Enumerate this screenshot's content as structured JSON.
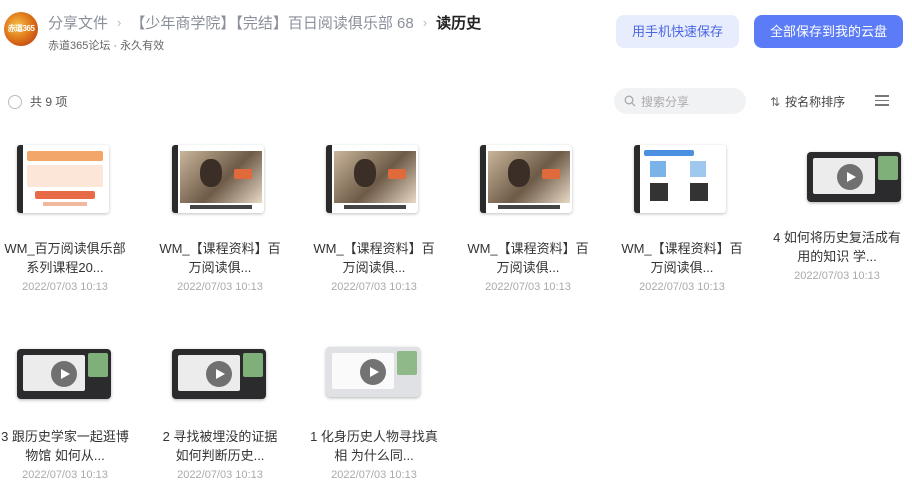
{
  "header": {
    "avatar_text": "赤道365",
    "breadcrumb": [
      "分享文件",
      "【少年商学院】【完结】百日阅读俱乐部 68"
    ],
    "current": "读历史",
    "subline": "赤道365论坛 · 永久有效",
    "btn_mobile": "用手机快速保存",
    "btn_saveall": "全部保存到我的云盘"
  },
  "toolbar": {
    "count": "共 9 项",
    "search_placeholder": "搜索分享",
    "sort": "按名称排序"
  },
  "files": [
    {
      "name": "WM_百万阅读俱乐部系列课程20...",
      "date": "2022/07/03 10:13",
      "kind": "doc-poster"
    },
    {
      "name": "WM_【课程资料】百万阅读俱...",
      "date": "2022/07/03 10:13",
      "kind": "doc-portrait"
    },
    {
      "name": "WM_【课程资料】百万阅读俱...",
      "date": "2022/07/03 10:13",
      "kind": "doc-portrait"
    },
    {
      "name": "WM_【课程资料】百万阅读俱...",
      "date": "2022/07/03 10:13",
      "kind": "doc-portrait"
    },
    {
      "name": "WM_【课程资料】百万阅读俱...",
      "date": "2022/07/03 10:13",
      "kind": "doc-qr"
    },
    {
      "name": "4 如何将历史复活成有用的知识 学...",
      "date": "2022/07/03 10:13",
      "kind": "video"
    },
    {
      "name": "3 跟历史学家一起逛博物馆 如何从...",
      "date": "2022/07/03 10:13",
      "kind": "video"
    },
    {
      "name": "2 寻找被埋没的证据 如何判断历史...",
      "date": "2022/07/03 10:13",
      "kind": "video"
    },
    {
      "name": "1 化身历史人物寻找真相 为什么同...",
      "date": "2022/07/03 10:13",
      "kind": "video-light"
    }
  ],
  "colors": {
    "primary": "#5b7cf6",
    "primary_light": "#e8edfd"
  }
}
